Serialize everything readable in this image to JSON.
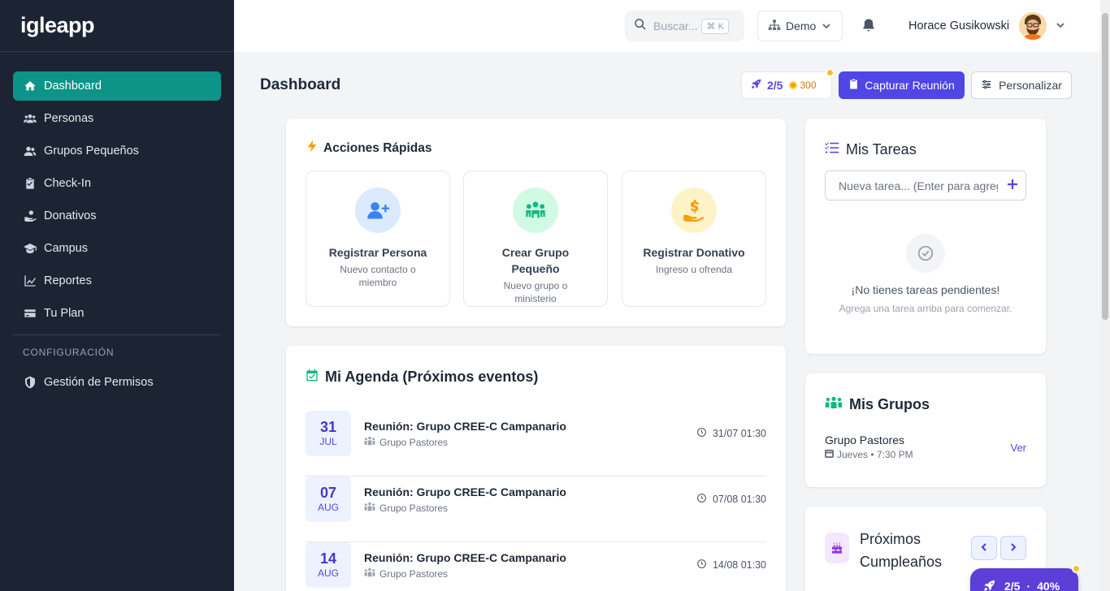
{
  "brand": "igleapp",
  "sidebar": {
    "items": [
      {
        "label": "Dashboard",
        "icon": "home-icon",
        "active": true
      },
      {
        "label": "Personas",
        "icon": "users-icon"
      },
      {
        "label": "Grupos Pequeños",
        "icon": "user-group-icon"
      },
      {
        "label": "Check-In",
        "icon": "clipboard-check-icon"
      },
      {
        "label": "Donativos",
        "icon": "hand-holding-icon"
      },
      {
        "label": "Campus",
        "icon": "graduation-cap-icon"
      },
      {
        "label": "Reportes",
        "icon": "chart-line-icon"
      },
      {
        "label": "Tu Plan",
        "icon": "credit-card-icon"
      }
    ],
    "section_label": "CONFIGURACIÓN",
    "config_items": [
      {
        "label": "Gestión de Permisos",
        "icon": "shield-icon"
      }
    ]
  },
  "topbar": {
    "search_placeholder": "Buscar...",
    "search_shortcut": "⌘ K",
    "org_label": "Demo",
    "user_name": "Horace Gusikowski"
  },
  "header": {
    "title": "Dashboard",
    "progress": "2/5",
    "points": "300",
    "primary_button": "Capturar Reunión",
    "secondary_button": "Personalizar"
  },
  "quick_actions": {
    "title": "Acciones Rápidas",
    "items": [
      {
        "title": "Registrar Persona",
        "subtitle": "Nuevo contacto o miembro",
        "icon": "user-plus-icon",
        "bg": "#dbeafe",
        "fg": "#3b82f6"
      },
      {
        "title": "Crear Grupo Pequeño",
        "subtitle": "Nuevo grupo o ministerio",
        "icon": "people-group-icon",
        "bg": "#d1fae5",
        "fg": "#10b981"
      },
      {
        "title": "Registrar Donativo",
        "subtitle": "Ingreso u ofrenda",
        "icon": "hand-dollar-icon",
        "bg": "#fef3c7",
        "fg": "#f59e0b"
      }
    ]
  },
  "agenda": {
    "title": "Mi Agenda (Próximos eventos)",
    "events": [
      {
        "day": "31",
        "month": "JUL",
        "title": "Reunión: Grupo CREE-C Campanario",
        "group": "Grupo Pastores",
        "time": "31/07 01:30"
      },
      {
        "day": "07",
        "month": "AUG",
        "title": "Reunión: Grupo CREE-C Campanario",
        "group": "Grupo Pastores",
        "time": "07/08 01:30"
      },
      {
        "day": "14",
        "month": "AUG",
        "title": "Reunión: Grupo CREE-C Campanario",
        "group": "Grupo Pastores",
        "time": "14/08 01:30"
      }
    ]
  },
  "tasks": {
    "title": "Mis Tareas",
    "input_placeholder": "Nueva tarea... (Enter para agregar)",
    "empty_title": "¡No tienes tareas pendientes!",
    "empty_subtitle": "Agrega una tarea arriba para comenzar."
  },
  "groups": {
    "title": "Mis Grupos",
    "items": [
      {
        "name": "Grupo Pastores",
        "schedule": "Jueves • 7:30 PM",
        "link": "Ver"
      }
    ]
  },
  "birthdays": {
    "title": "Próximos Cumpleaños"
  },
  "fab": {
    "progress": "2/5",
    "separator": "·",
    "percent": "40%"
  },
  "colors": {
    "sidebar_bg": "#1c2434",
    "active_nav": "#0d9488",
    "primary": "#4f46e5",
    "fab": "#5b3fd6"
  }
}
